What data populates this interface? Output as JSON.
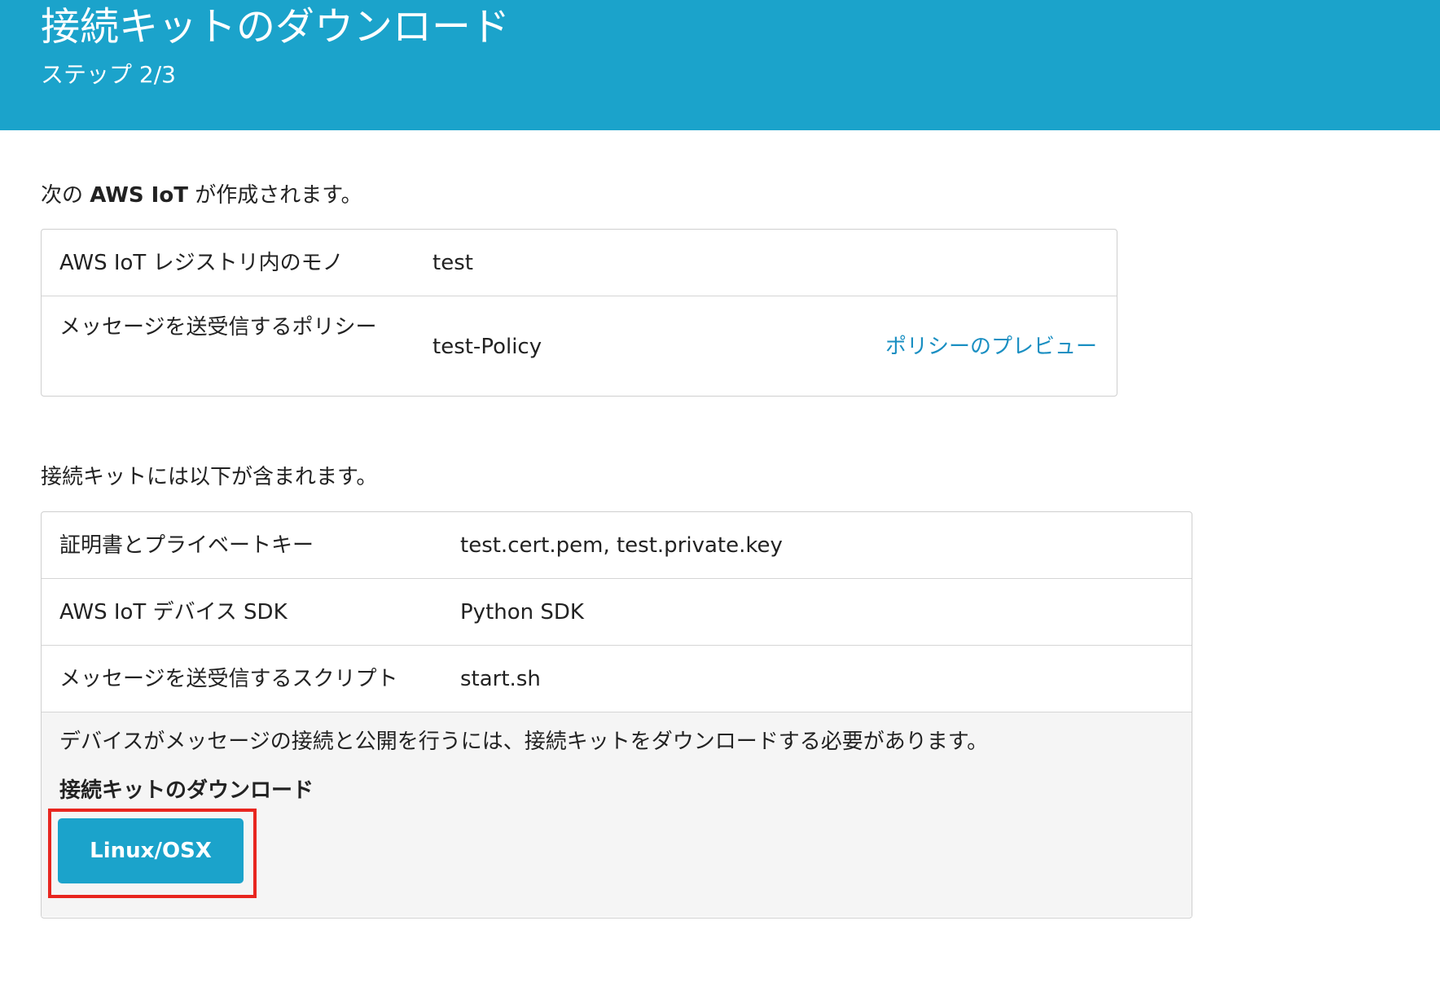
{
  "header": {
    "title": "接続キットのダウンロード",
    "step": "ステップ 2/3"
  },
  "created": {
    "intro_prefix": "次の ",
    "intro_bold": "AWS IoT",
    "intro_suffix": " が作成されます。",
    "rows": [
      {
        "label": "AWS IoT レジストリ内のモノ",
        "value": "test"
      },
      {
        "label": "メッセージを送受信するポリシー",
        "value": "test-Policy",
        "link": "ポリシーのプレビュー"
      }
    ]
  },
  "kit": {
    "intro": "接続キットには以下が含まれます。",
    "rows": [
      {
        "label": "証明書とプライベートキー",
        "value": "test.cert.pem, test.private.key"
      },
      {
        "label": "AWS IoT デバイス SDK",
        "value": "Python SDK"
      },
      {
        "label": "メッセージを送受信するスクリプト",
        "value": "start.sh"
      }
    ],
    "note": "デバイスがメッセージの接続と公開を行うには、接続キットをダウンロードする必要があります。",
    "download_heading": "接続キットのダウンロード",
    "download_button": "Linux/OSX"
  },
  "colors": {
    "header_bg": "#1ba3cb",
    "link": "#1a8fc2",
    "button_bg": "#1ba3cb",
    "highlight_border": "#e8261f"
  }
}
